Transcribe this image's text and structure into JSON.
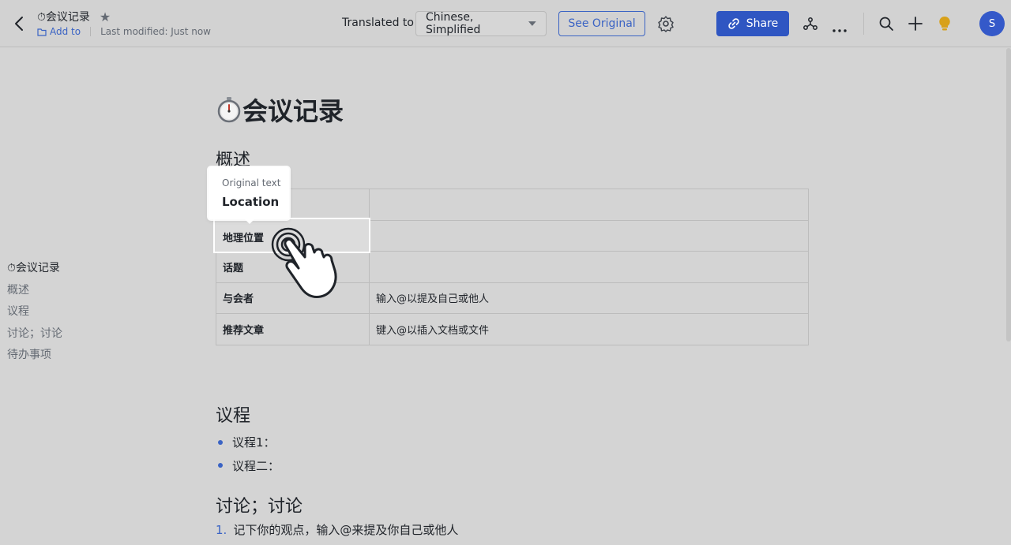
{
  "header": {
    "doc_title": "⏱会议记录",
    "add_to": "Add to",
    "last_modified": "Last modified: Just now",
    "translated_to_label": "Translated to",
    "language": "Chinese, Simplified",
    "see_original": "See Original",
    "share": "Share",
    "avatar_initial": "S",
    "accent_color": "#2f56c2"
  },
  "outline": {
    "items": [
      "⏱会议记录",
      "概述",
      "议程",
      "讨论；讨论",
      "待办事项"
    ]
  },
  "doc": {
    "title_emoji": "⏱",
    "title": "会议记录",
    "overview_heading": "概述",
    "table": [
      {
        "key": "",
        "value": ""
      },
      {
        "key": "地理位置",
        "value": ""
      },
      {
        "key": "话题",
        "value": ""
      },
      {
        "key": "与会者",
        "value": "输入@以提及自己或他人"
      },
      {
        "key": "推荐文章",
        "value": "键入@以插入文档或文件"
      }
    ],
    "tooltip": {
      "label": "Original text",
      "value": "Location"
    },
    "agenda_heading": "议程",
    "agenda_items": [
      "议程1：",
      "议程二："
    ],
    "discuss_heading": "讨论；讨论",
    "discuss_item_number": "1.",
    "discuss_item": "记下你的观点，输入@来提及你自己或他人"
  },
  "icons": [
    "back-icon",
    "star-icon",
    "folder-icon",
    "chevron-down-icon",
    "gear-icon",
    "link-icon",
    "share-graph-icon",
    "more-icon",
    "search-icon",
    "plus-icon",
    "lightbulb-icon",
    "hand-pointer-icon",
    "stopwatch-icon"
  ]
}
